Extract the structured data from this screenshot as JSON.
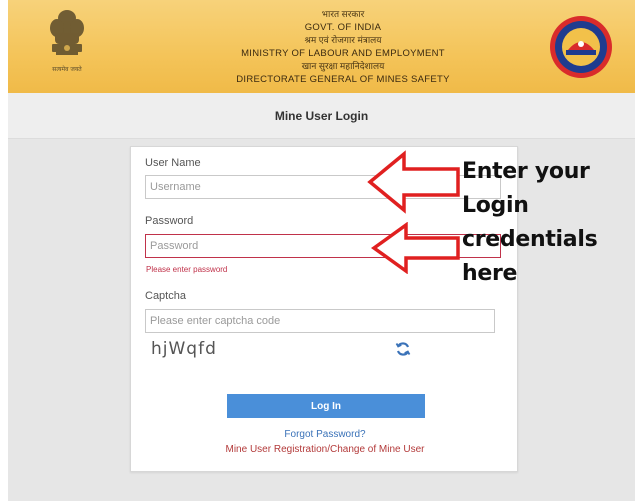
{
  "header": {
    "hindi_line1": "भारत सरकार",
    "line1": "GOVT. OF INDIA",
    "hindi_line2": "श्रम एवं रोजगार मंत्रालय",
    "line2": "MINISTRY OF LABOUR AND EMPLOYMENT",
    "hindi_line3": "खान सुरक्षा महानिदेशालय",
    "line3": "DIRECTORATE GENERAL OF MINES SAFETY",
    "emblem_icon": "national-emblem-icon",
    "logo_icon": "dgms-logo-icon"
  },
  "subheader": {
    "title": "Mine User Login"
  },
  "form": {
    "username_label": "User Name",
    "username_placeholder": "Username",
    "password_label": "Password",
    "password_placeholder": "Password",
    "password_error": "Please enter password",
    "captcha_label": "Captcha",
    "captcha_placeholder": "Please enter captcha code",
    "captcha_code": "hjWqfd",
    "refresh_icon": "refresh-icon",
    "login_button": "Log In",
    "forgot_link": "Forgot Password?",
    "register_link": "Mine User Registration/Change of Mine User"
  },
  "annotation": {
    "lines": [
      "Enter your",
      "Login",
      "credentials",
      "here"
    ],
    "arrow_color": "#e02020"
  },
  "colors": {
    "banner": "#f4c459",
    "button": "#4a8fd9",
    "error": "#c0324a"
  }
}
